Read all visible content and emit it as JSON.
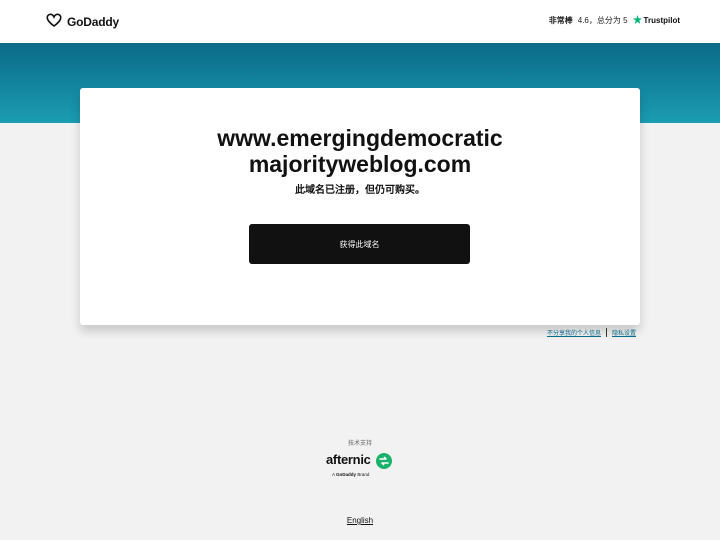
{
  "header": {
    "logo_text": "GoDaddy",
    "rating_word": "非常棒",
    "rating_text": "4.6，总分为 5",
    "trustpilot": "Trustpilot"
  },
  "card": {
    "domain_line1": "www.emergingdemocratic",
    "domain_line2": "majorityweblog.com",
    "subtitle": "此域名已注册，但仍可购买。",
    "buy_button": "获得此域名"
  },
  "privacy": {
    "do_not_share": "不分享我的个人信息",
    "settings": "隐私设置"
  },
  "footer": {
    "powered_by": "技术支持",
    "brand": "afternic",
    "brand_sub_prefix": "A",
    "brand_sub_logo": "GoDaddy",
    "brand_sub_suffix": "Brand",
    "language": "English"
  },
  "colors": {
    "band_top": "#0b6a88",
    "band_bottom": "#1b9db2",
    "button": "#111111",
    "trustpilot_star": "#00b67a",
    "afternic_green": "#1bb36b"
  }
}
